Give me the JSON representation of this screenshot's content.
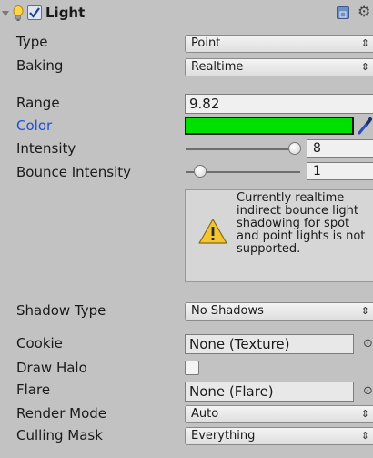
{
  "header": {
    "title": "Light",
    "enabled": true
  },
  "fields": {
    "type": {
      "label": "Type",
      "value": "Point"
    },
    "baking": {
      "label": "Baking",
      "value": "Realtime"
    },
    "range": {
      "label": "Range",
      "value": "9.82"
    },
    "color": {
      "label": "Color",
      "value": "#00e000"
    },
    "intensity": {
      "label": "Intensity",
      "value": "8",
      "slider_fraction": 0.95
    },
    "bounce_intensity": {
      "label": "Bounce Intensity",
      "value": "1",
      "slider_fraction": 0.12
    },
    "shadow_type": {
      "label": "Shadow Type",
      "value": "No Shadows"
    },
    "cookie": {
      "label": "Cookie",
      "value": "None (Texture)"
    },
    "draw_halo": {
      "label": "Draw Halo",
      "checked": false
    },
    "flare": {
      "label": "Flare",
      "value": "None (Flare)"
    },
    "render_mode": {
      "label": "Render Mode",
      "value": "Auto"
    },
    "culling_mask": {
      "label": "Culling Mask",
      "value": "Everything"
    }
  },
  "help": {
    "message": "Currently realtime indirect bounce light shadowing for spot and point lights is not supported."
  },
  "icons": {
    "foldout": "foldout-arrow-icon",
    "bulb": "light-bulb-icon",
    "help": "help-book-icon",
    "settings": "gear-icon",
    "eyedropper": "eyedropper-icon",
    "warning": "warning-icon",
    "object_picker": "object-picker-icon"
  }
}
